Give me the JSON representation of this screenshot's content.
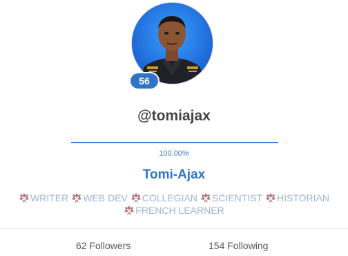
{
  "profile": {
    "level": "56",
    "username": "@tomiajax",
    "progress_percent": 100,
    "progress_label": "100.00%",
    "display_name": "Tomi-Ajax",
    "tags": [
      {
        "label": "WRITER",
        "icon": "badge-icon"
      },
      {
        "label": "WEB DEV",
        "icon": "badge-icon"
      },
      {
        "label": "COLLEGIAN",
        "icon": "badge-icon"
      },
      {
        "label": "SCIENTIST",
        "icon": "badge-icon"
      },
      {
        "label": "HISTORIAN",
        "icon": "badge-icon"
      },
      {
        "label": "FRENCH LEARNER",
        "icon": "badge-icon"
      }
    ],
    "followers": "62 Followers",
    "following": "154 Following"
  },
  "colors": {
    "accent": "#2f74c9",
    "progress": "#3a7bd5",
    "tag_text": "#9fb5d6",
    "tag_icon": "#b07c86"
  }
}
